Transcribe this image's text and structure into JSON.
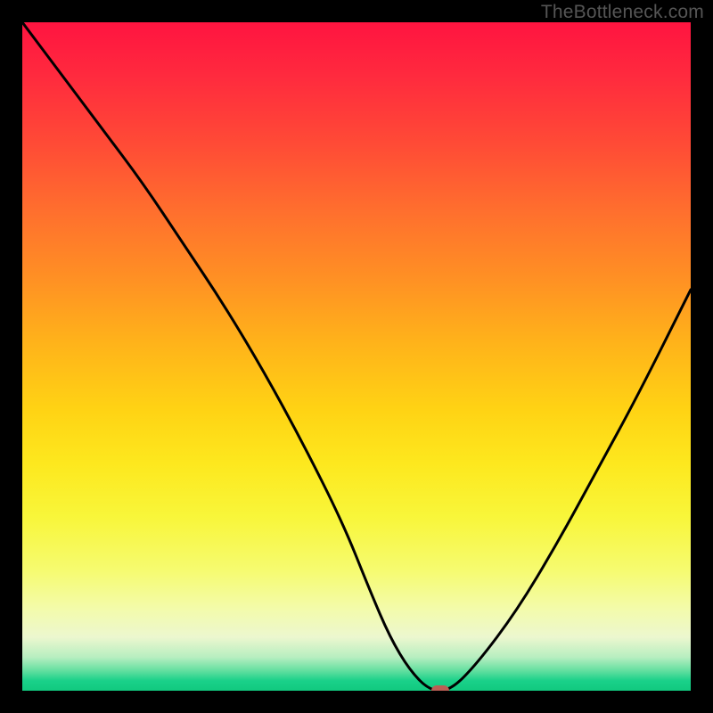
{
  "watermark": "TheBottleneck.com",
  "chart_data": {
    "type": "line",
    "title": "",
    "xlabel": "",
    "ylabel": "",
    "xlim": [
      0,
      100
    ],
    "ylim": [
      0,
      100
    ],
    "grid": false,
    "legend": false,
    "series": [
      {
        "name": "curve",
        "x": [
          0,
          6,
          12,
          18,
          24,
          30,
          36,
          42,
          48,
          52,
          55,
          58,
          61,
          64,
          68,
          74,
          80,
          86,
          92,
          100
        ],
        "values": [
          100,
          92,
          84,
          76,
          67,
          58,
          48,
          37,
          25,
          15,
          8,
          3,
          0,
          0,
          4,
          12,
          22,
          33,
          44,
          60
        ]
      }
    ],
    "marker": {
      "x": 62.5,
      "y": 0
    },
    "colors": {
      "gradient_top": "#ff1440",
      "gradient_bottom": "#11c97f",
      "curve": "#000000",
      "marker": "#bb5e54",
      "frame": "#000000"
    }
  }
}
